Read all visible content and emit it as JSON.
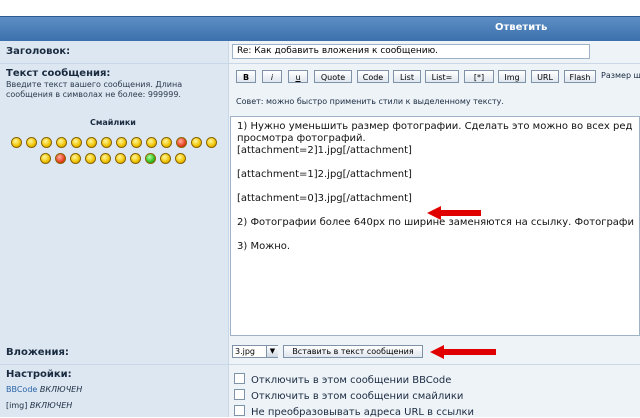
{
  "header": {
    "title": "Ответить"
  },
  "subject": {
    "label": "Заголовок:",
    "value": "Re: Как добавить вложения к сообщению."
  },
  "message": {
    "label": "Текст сообщения:",
    "hint": "Введите текст вашего сообщения. Длина сообщения в символах не более: 999999.",
    "smilies_title": "Смайлики",
    "tip": "Совет: можно быстро применить стили к выделенному тексту.",
    "toolbar": [
      "B",
      "i",
      "u",
      "Quote",
      "Code",
      "List",
      "List=",
      "[*]",
      "Img",
      "URL",
      "Flash"
    ],
    "font_size_label": "Размер ш",
    "lines": [
      "1) Нужно уменьшить размер фотографии. Сделать это можно во всех ред",
      "просмотра фотографий.",
      "[attachment=2]1.jpg[/attachment]",
      "",
      "[attachment=1]2.jpg[/attachment]",
      "",
      "[attachment=0]3.jpg[/attachment]",
      "",
      "2) Фотографии более 640px по ширине заменяются на ссылку. Фотографи",
      "",
      "3) Можно."
    ]
  },
  "attachments": {
    "label": "Вложения:",
    "selected": "3.jpg",
    "insert_button": "Вставить в текст сообщения"
  },
  "settings": {
    "label": "Настройки:",
    "bbcode": {
      "link": "BBCode",
      "status": "ВКЛЮЧЕН"
    },
    "img": {
      "tag": "[img]",
      "status": "ВКЛЮЧЕН"
    },
    "options": [
      "Отключить в этом сообщении BBCode",
      "Отключить в этом сообщении смайлики",
      "Не преобразовывать адреса URL в ссылки"
    ]
  },
  "colors": {
    "header": "#3b70ad",
    "row_bg": "#eef3f8",
    "label_bg": "#dde7f2",
    "arrow": "#e00000"
  }
}
